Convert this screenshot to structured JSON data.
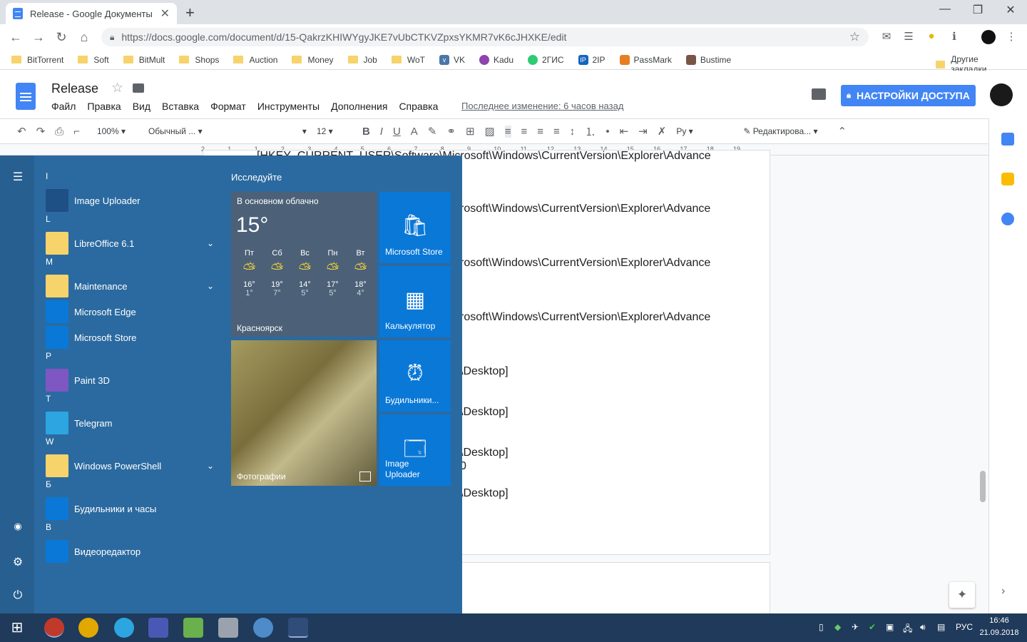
{
  "browser": {
    "tab_title": "Release - Google Документы",
    "url": "https://docs.google.com/document/d/15-QakrzKHIWYgyJKE7vUbCTKVZpxsYKMR7vK6cJHXKE/edit",
    "bookmarks": [
      "BitTorrent",
      "Soft",
      "BitMult",
      "Shops",
      "Auction",
      "Money",
      "Job",
      "WoT",
      "VK",
      "Kadu",
      "2ГИС",
      "2IP",
      "PassMark",
      "Bustime"
    ],
    "other_bookmarks": "Другие закладки"
  },
  "docs": {
    "title": "Release",
    "menu": [
      "Файл",
      "Правка",
      "Вид",
      "Вставка",
      "Формат",
      "Инструменты",
      "Дополнения",
      "Справка"
    ],
    "last_edit": "Последнее изменение: 6 часов назад",
    "share_label": "НАСТРОЙКИ ДОСТУПА",
    "zoom": "100%",
    "style": "Обычный ...",
    "font_size": "12",
    "lang": "Ру",
    "mode": "Редактирова...",
    "ruler": [
      "2",
      "1",
      "1",
      "2",
      "3",
      "4",
      "5",
      "6",
      "7",
      "8",
      "9",
      "10",
      "11",
      "12",
      "13",
      "14",
      "15",
      "16",
      "17",
      "18",
      "19"
    ],
    "lines": [
      "[HKEY_CURRENT_USER\\Software\\Microsoft\\Windows\\CurrentVersion\\Explorer\\Advance",
      "rosoft\\Windows\\CurrentVersion\\Explorer\\Advance",
      "rosoft\\Windows\\CurrentVersion\\Explorer\\Advance",
      "rosoft\\Windows\\CurrentVersion\\Explorer\\Advance",
      "\\Desktop]",
      "\\Desktop]",
      "\\Desktop]",
      "0",
      "\\Desktop]"
    ]
  },
  "start": {
    "explore": "Исследуйте",
    "groups": [
      {
        "letter": "I",
        "apps": [
          {
            "name": "Image Uploader",
            "expand": false
          }
        ]
      },
      {
        "letter": "L",
        "apps": [
          {
            "name": "LibreOffice 6.1",
            "expand": true
          }
        ]
      },
      {
        "letter": "M",
        "apps": [
          {
            "name": "Maintenance",
            "expand": true
          },
          {
            "name": "Microsoft Edge",
            "expand": false
          },
          {
            "name": "Microsoft Store",
            "expand": false
          }
        ]
      },
      {
        "letter": "P",
        "apps": [
          {
            "name": "Paint 3D",
            "expand": false
          }
        ]
      },
      {
        "letter": "T",
        "apps": [
          {
            "name": "Telegram",
            "expand": false
          }
        ]
      },
      {
        "letter": "W",
        "apps": [
          {
            "name": "Windows PowerShell",
            "expand": true
          }
        ]
      },
      {
        "letter": "Б",
        "apps": [
          {
            "name": "Будильники и часы",
            "expand": false
          }
        ]
      },
      {
        "letter": "В",
        "apps": [
          {
            "name": "Видеоредактор",
            "expand": false
          }
        ]
      }
    ],
    "weather": {
      "condition": "В основном облачно",
      "temp": "15°",
      "city": "Красноярск",
      "days": [
        {
          "d": "Пт",
          "hi": "16°",
          "lo": "1°"
        },
        {
          "d": "Сб",
          "hi": "19°",
          "lo": "7°"
        },
        {
          "d": "Вс",
          "hi": "14°",
          "lo": "5°"
        },
        {
          "d": "Пн",
          "hi": "17°",
          "lo": "5°"
        },
        {
          "d": "Вт",
          "hi": "18°",
          "lo": "4°"
        }
      ]
    },
    "tiles": {
      "store": "Microsoft Store",
      "calc": "Калькулятор",
      "alarms": "Будильники...",
      "photos": "Фотографии",
      "uploader_1": "Image",
      "uploader_2": "Uploader"
    }
  },
  "taskbar": {
    "lang": "РУС",
    "time": "16:46",
    "date": "21.09.2018"
  }
}
